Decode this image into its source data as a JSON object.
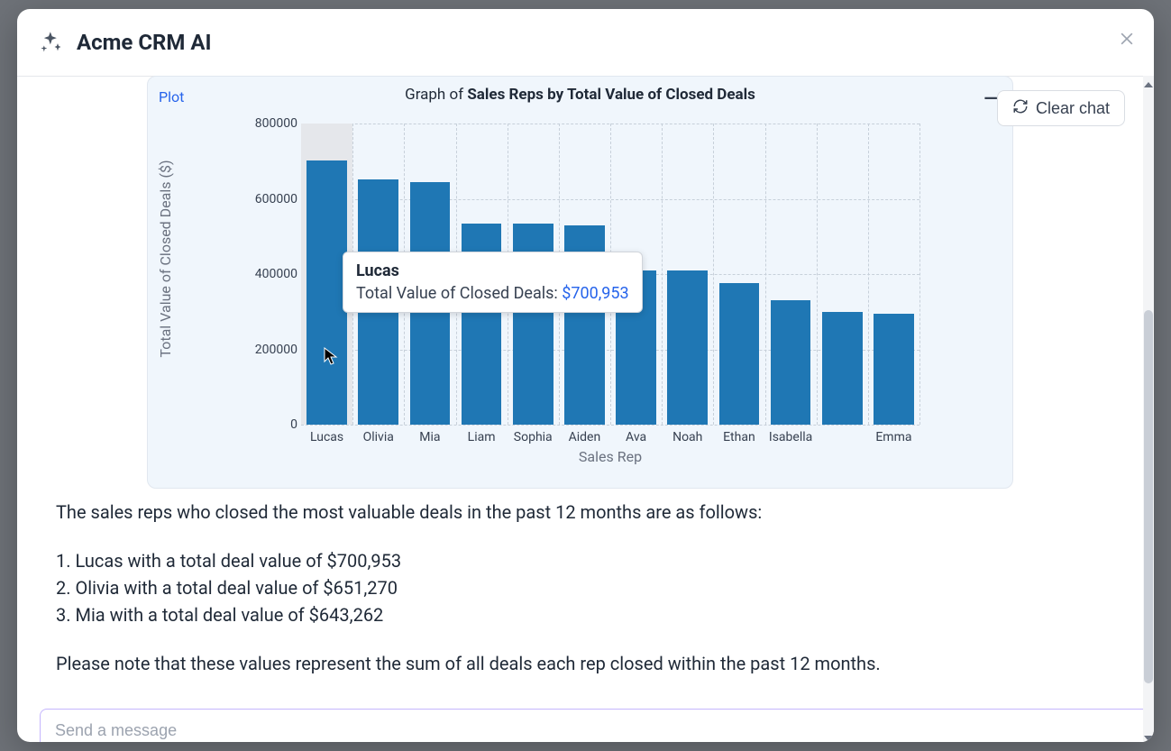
{
  "header": {
    "title": "Acme CRM AI"
  },
  "clear_chat_label": "Clear chat",
  "chart": {
    "tab_label": "Plot",
    "title_prefix": "Graph of ",
    "title_bold": "Sales Reps by Total Value of Closed Deals"
  },
  "tooltip": {
    "name": "Lucas",
    "metric_label": "Total Value of Closed Deals: ",
    "value_text": "$700,953"
  },
  "chart_data": {
    "type": "bar",
    "title": "Graph of Sales Reps by Total Value of Closed Deals",
    "xlabel": "Sales Rep",
    "ylabel": "Total Value of Closed Deals ($)",
    "ylim": [
      0,
      800000
    ],
    "yticks": [
      0,
      200000,
      400000,
      600000,
      800000
    ],
    "categories": [
      "Lucas",
      "Olivia",
      "Mia",
      "Liam",
      "Sophia",
      "Aiden",
      "Ava",
      "Noah",
      "Ethan",
      "Isabella",
      "",
      "Emma"
    ],
    "values": [
      700953,
      651270,
      643262,
      535000,
      535000,
      530000,
      410000,
      410000,
      375000,
      330000,
      300000,
      295000
    ]
  },
  "response": {
    "intro": "The sales reps who closed the most valuable deals in the past 12 months are as follows:",
    "items": [
      "Lucas with a total deal value of $700,953",
      "Olivia with a total deal value of $651,270",
      "Mia with a total deal value of $643,262"
    ],
    "note": "Please note that these values represent the sum of all deals each rep closed within the past 12 months."
  },
  "composer": {
    "placeholder": "Send a message"
  }
}
